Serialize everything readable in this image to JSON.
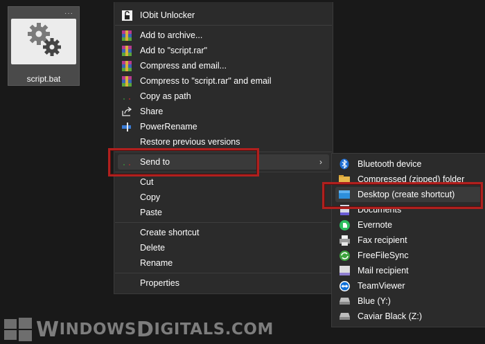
{
  "file": {
    "name": "script.bat",
    "icon": "gears-icon"
  },
  "main_menu": {
    "items": [
      {
        "label": "IObit Unlocker",
        "icon": "iobit-unlocker-icon"
      },
      {
        "label": "Add to archive...",
        "icon": "winrar-icon"
      },
      {
        "label": "Add to \"script.rar\"",
        "icon": "winrar-icon"
      },
      {
        "label": "Compress and email...",
        "icon": "winrar-icon"
      },
      {
        "label": "Compress to \"script.rar\" and email",
        "icon": "winrar-icon"
      },
      {
        "label": "Copy as path",
        "icon": "copy-path-icon"
      },
      {
        "label": "Share",
        "icon": "share-icon"
      },
      {
        "label": "PowerRename",
        "icon": "powerrename-icon"
      },
      {
        "label": "Restore previous versions",
        "icon": "none"
      },
      {
        "label": "Send to",
        "icon": "send-to-icon",
        "arrow": "›"
      },
      {
        "label": "Cut",
        "icon": "none"
      },
      {
        "label": "Copy",
        "icon": "none"
      },
      {
        "label": "Paste",
        "icon": "none"
      },
      {
        "label": "Create shortcut",
        "icon": "none"
      },
      {
        "label": "Delete",
        "icon": "none"
      },
      {
        "label": "Rename",
        "icon": "none"
      },
      {
        "label": "Properties",
        "icon": "none"
      }
    ]
  },
  "send_to_menu": {
    "items": [
      {
        "label": "Bluetooth device",
        "icon": "bluetooth-icon"
      },
      {
        "label": "Compressed (zipped) folder",
        "icon": "zip-folder-icon"
      },
      {
        "label": "Desktop (create shortcut)",
        "icon": "desktop-icon"
      },
      {
        "label": "Documents",
        "icon": "documents-icon"
      },
      {
        "label": "Evernote",
        "icon": "evernote-icon"
      },
      {
        "label": "Fax recipient",
        "icon": "fax-icon"
      },
      {
        "label": "FreeFileSync",
        "icon": "freefilesync-icon"
      },
      {
        "label": "Mail recipient",
        "icon": "mail-icon"
      },
      {
        "label": "TeamViewer",
        "icon": "teamviewer-icon"
      },
      {
        "label": "Blue (Y:)",
        "icon": "drive-icon"
      },
      {
        "label": "Caviar Black (Z:)",
        "icon": "drive-icon"
      }
    ]
  },
  "watermark": {
    "text_big_1": "W",
    "text_small_1": "INDOWS",
    "text_big_2": "D",
    "text_small_2": "IGITALS.COM"
  },
  "colors": {
    "highlight_box": "#b0201e",
    "menu_bg": "#2b2b2b",
    "desktop_bg": "#191919"
  }
}
